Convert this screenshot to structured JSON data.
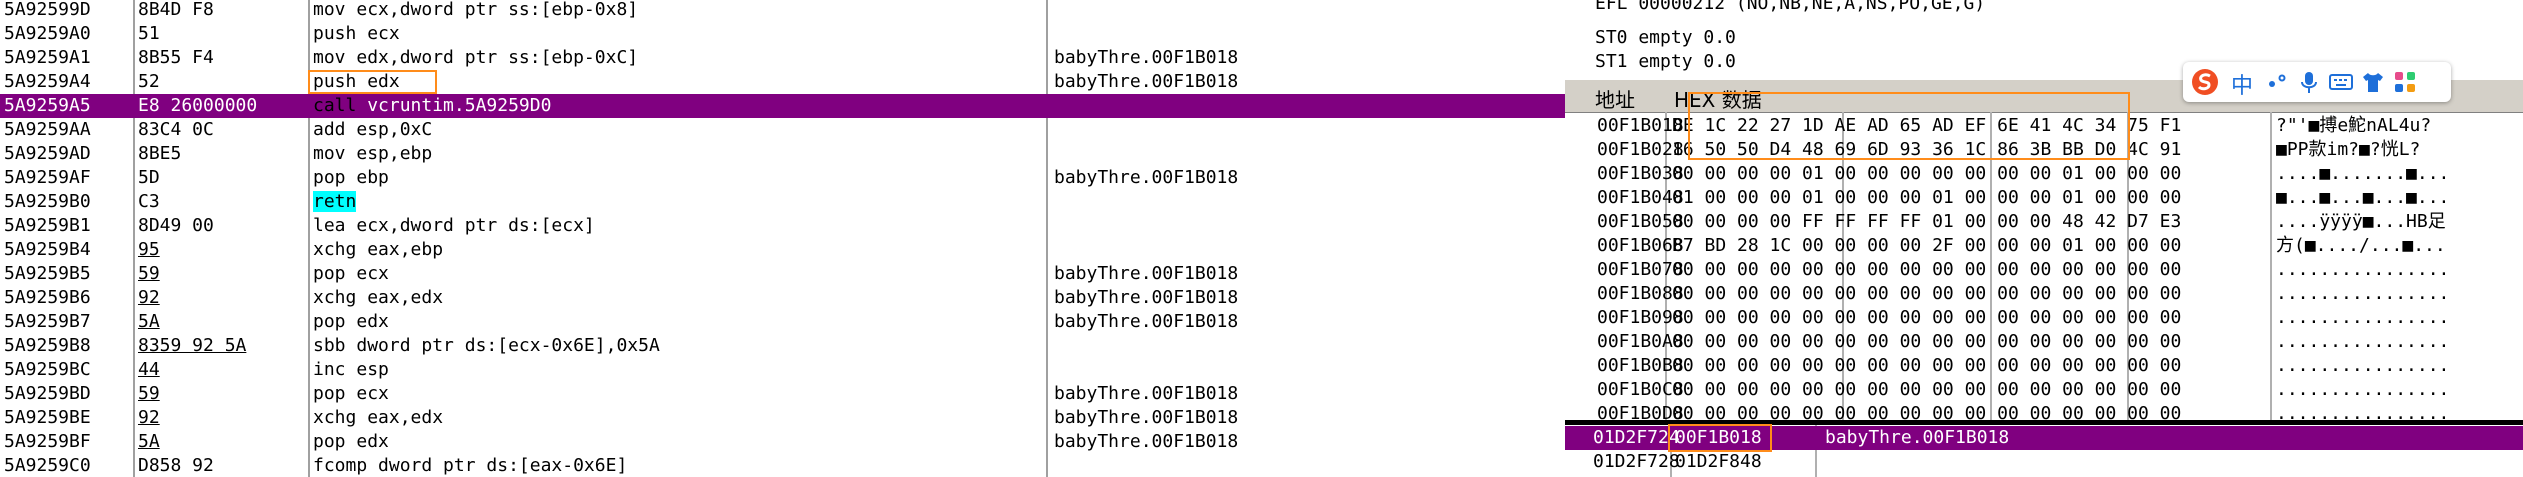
{
  "disasm": {
    "rows": [
      {
        "addr": "5A92599D",
        "bytes": "8B4D F8",
        "mn": "mov",
        "ops": "ecx,dword ptr ss:[ebp-0x8]",
        "comment": ""
      },
      {
        "addr": "5A9259A0",
        "bytes": "51",
        "mn": "push",
        "ops": "ecx",
        "comment": ""
      },
      {
        "addr": "5A9259A1",
        "bytes": "8B55 F4",
        "mn": "mov",
        "ops": "edx,dword ptr ss:[ebp-0xC]",
        "comment": "babyThre.00F1B018"
      },
      {
        "addr": "5A9259A4",
        "bytes": "52",
        "mn": "push",
        "ops": "edx",
        "comment": "babyThre.00F1B018"
      },
      {
        "addr": "5A9259A5",
        "bytes": "E8 26000000",
        "mn": "call",
        "ops": "vcruntim.5A9259D0",
        "comment": ""
      },
      {
        "addr": "5A9259AA",
        "bytes": "83C4 0C",
        "mn": "add",
        "ops": "esp,",
        "imm": "0xC",
        "comment": ""
      },
      {
        "addr": "5A9259AD",
        "bytes": "8BE5",
        "mn": "mov",
        "ops": "esp,ebp",
        "comment": ""
      },
      {
        "addr": "5A9259AF",
        "bytes": "5D",
        "mn": "pop",
        "ops": "ebp",
        "comment": "babyThre.00F1B018"
      },
      {
        "addr": "5A9259B0",
        "bytes": "C3",
        "mn": "retn",
        "ops": "",
        "comment": ""
      },
      {
        "addr": "5A9259B1",
        "bytes": "8D49 00",
        "mn": "lea",
        "ops": "ecx,dword ptr ds:[ecx]",
        "comment": ""
      },
      {
        "addr": "5A9259B4",
        "bytes": "95",
        "mn": "xchg",
        "ops": "eax,ebp",
        "comment": ""
      },
      {
        "addr": "5A9259B5",
        "bytes": "59",
        "mn": "pop",
        "ops": "ecx",
        "comment": "babyThre.00F1B018"
      },
      {
        "addr": "5A9259B6",
        "bytes": "92",
        "mn": "xchg",
        "ops": "eax,edx",
        "comment": "babyThre.00F1B018"
      },
      {
        "addr": "5A9259B7",
        "bytes": "5A",
        "mn": "pop",
        "ops": "edx",
        "comment": "babyThre.00F1B018"
      },
      {
        "addr": "5A9259B8",
        "bytes": "8359 92 5A",
        "mn": "sbb",
        "ops": "dword ptr ds:[ecx-0x6E],",
        "imm": "0x5A",
        "comment": ""
      },
      {
        "addr": "5A9259BC",
        "bytes": "44",
        "mn": "inc",
        "ops": "esp",
        "comment": ""
      },
      {
        "addr": "5A9259BD",
        "bytes": "59",
        "mn": "pop",
        "ops": "ecx",
        "comment": "babyThre.00F1B018"
      },
      {
        "addr": "5A9259BE",
        "bytes": "92",
        "mn": "xchg",
        "ops": "eax,edx",
        "comment": "babyThre.00F1B018"
      },
      {
        "addr": "5A9259BF",
        "bytes": "5A",
        "mn": "pop",
        "ops": "edx",
        "comment": "babyThre.00F1B018"
      },
      {
        "addr": "5A9259C0",
        "bytes": "D858 92",
        "mn": "fcomp",
        "ops": "dword ptr ds:[eax-0x6E]",
        "comment": ""
      }
    ]
  },
  "registers": {
    "efl": "EFL 00000212 (NO,NB,NE,A,NS,PO,GE,G)",
    "st0": "ST0 empty 0.0",
    "st1": "ST1 empty 0.0"
  },
  "dump": {
    "col_addr": "地址",
    "col_hex": "HEX 数据",
    "rows": [
      {
        "addr": "00F1B018",
        "hex": "DE 1C 22 27 1D AE AD 65 AD EF 6E 41 4C 34 75 F1",
        "ascii": "?\"'■搏e鮀nAL4u?"
      },
      {
        "addr": "00F1B028",
        "hex": "16 50 50 D4 48 69 6D 93 36 1C 86 3B BB D0 4C 91",
        "ascii": "■PP款im?■?恍L?"
      },
      {
        "addr": "00F1B038",
        "hex": "00 00 00 00 01 00 00 00 00 00 00 00 01 00 00 00",
        "ascii": "....■.......■..."
      },
      {
        "addr": "00F1B048",
        "hex": "01 00 00 00 01 00 00 00 01 00 00 00 01 00 00 00",
        "ascii": "■...■...■...■..."
      },
      {
        "addr": "00F1B058",
        "hex": "00 00 00 00 FF FF FF FF 01 00 00 00 48 42 D7 E3",
        "ascii": "....ÿÿÿÿ■...HB足"
      },
      {
        "addr": "00F1B068",
        "hex": "B7 BD 28 1C 00 00 00 00 2F 00 00 00 01 00 00 00",
        "ascii": "方(■..../...■..."
      },
      {
        "addr": "00F1B078",
        "hex": "00 00 00 00 00 00 00 00 00 00 00 00 00 00 00 00",
        "ascii": "................"
      },
      {
        "addr": "00F1B088",
        "hex": "00 00 00 00 00 00 00 00 00 00 00 00 00 00 00 00",
        "ascii": "................"
      },
      {
        "addr": "00F1B098",
        "hex": "00 00 00 00 00 00 00 00 00 00 00 00 00 00 00 00",
        "ascii": "................"
      },
      {
        "addr": "00F1B0A8",
        "hex": "00 00 00 00 00 00 00 00 00 00 00 00 00 00 00 00",
        "ascii": "................"
      },
      {
        "addr": "00F1B0B8",
        "hex": "00 00 00 00 00 00 00 00 00 00 00 00 00 00 00 00",
        "ascii": "................"
      },
      {
        "addr": "00F1B0C8",
        "hex": "00 00 00 00 00 00 00 00 00 00 00 00 00 00 00 00",
        "ascii": "................"
      },
      {
        "addr": "00F1B0D8",
        "hex": "00 00 00 00 00 00 00 00 00 00 00 00 00 00 00 00",
        "ascii": "................"
      }
    ]
  },
  "stack": {
    "rows": [
      {
        "addr": "01D2F724",
        "val": "00F1B018",
        "comment": "babyThre.00F1B018"
      },
      {
        "addr": "01D2F728",
        "val": "01D2F848",
        "comment": ""
      }
    ]
  },
  "ime": {
    "lang_label": "中",
    "icons": [
      "sogou-logo-icon",
      "punctuation-icon",
      "microphone-icon",
      "keyboard-icon",
      "skin-shirt-icon",
      "toolbox-grid-icon"
    ]
  },
  "colors": {
    "selection": "#800080",
    "highlight_box": "#ff8c1a",
    "push_pop": "#6a5cff",
    "call": "#ffd200",
    "retn_bg": "#00ffff",
    "fcomp": "#ff2020",
    "immediate": "#008800"
  }
}
